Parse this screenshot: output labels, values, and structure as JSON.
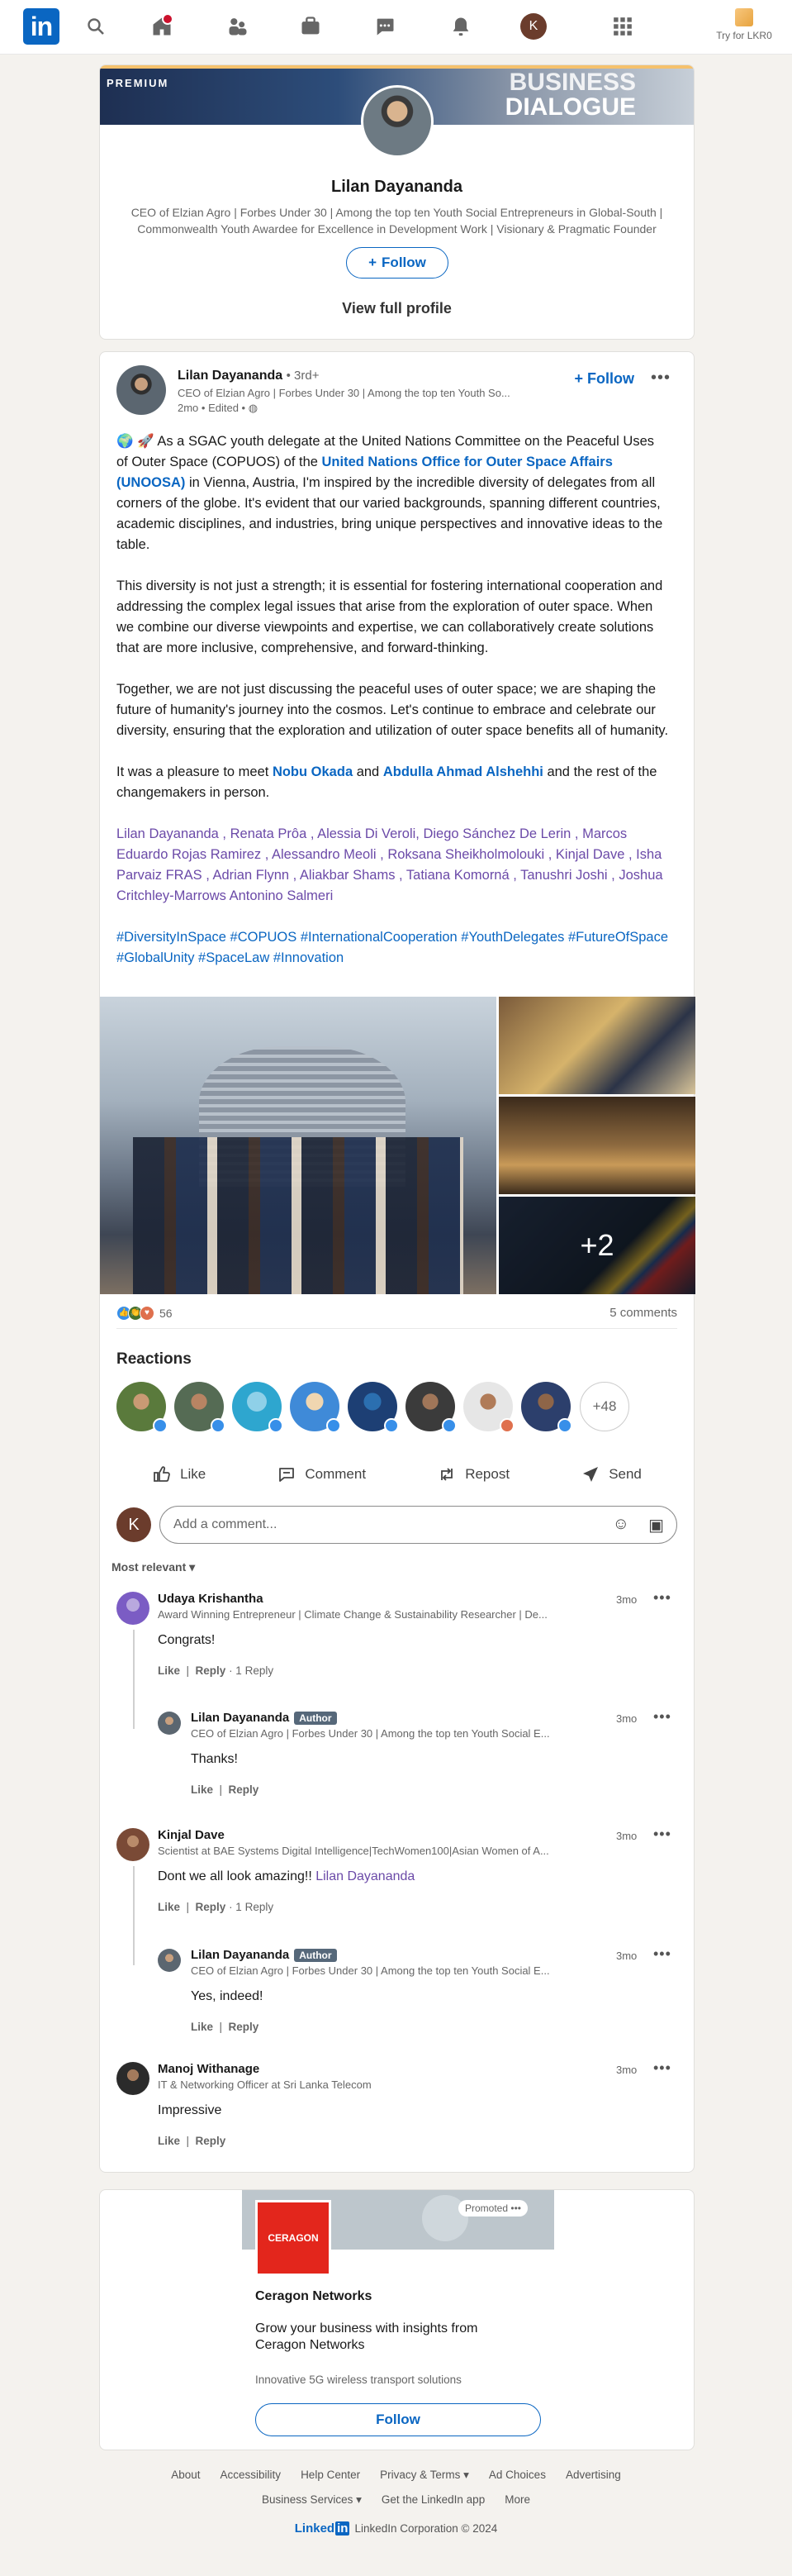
{
  "nav": {
    "logo": "in",
    "me_initial": "K",
    "premium_label": "Try for LKR0"
  },
  "profile_card": {
    "banner_label": "PREMIUM",
    "banner_text_1": "BUSINESS",
    "banner_text_2": "DIALOGUE",
    "name": "Lilan Dayananda",
    "headline": "CEO of Elzian Agro | Forbes Under 30 | Among the top ten Youth Social Entrepreneurs in Global-South | Commonwealth Youth Awardee for Excellence in Development Work | Visionary & Pragmatic Founder",
    "follow_label": "Follow",
    "view_profile_label": "View full profile"
  },
  "post": {
    "author": "Lilan Dayananda",
    "degree": "• 3rd+",
    "headline": "CEO of Elzian Agro | Forbes Under 30 | Among the top ten Youth So...",
    "time": "2mo • Edited •",
    "follow_label": "Follow",
    "p1_a": "🌍 🚀 As a SGAC youth delegate at the United Nations Committee on the Peaceful Uses of Outer Space (COPUOS) of the ",
    "p1_link": "United Nations Office for Outer Space Affairs (UNOOSA)",
    "p1_b": " in Vienna, Austria, I'm inspired by the incredible diversity of delegates from all corners of the globe. It's evident that our varied backgrounds, spanning different countries, academic disciplines, and industries, bring unique perspectives and innovative ideas to the table.",
    "p2": "This diversity is not just a strength; it is essential for fostering international cooperation and addressing the complex legal issues that arise from the exploration of outer space. When we combine our diverse viewpoints and expertise, we can collaboratively create solutions that are more inclusive, comprehensive, and forward-thinking.",
    "p3": "Together, we are not just discussing the peaceful uses of outer space; we are shaping the future of humanity's journey into the cosmos. Let's continue to embrace and celebrate our diversity, ensuring that the exploration and utilization of outer space benefits all of humanity.",
    "p4_a": "It was a pleasure to meet ",
    "p4_l1": "Nobu Okada",
    "p4_b": " and ",
    "p4_l2": "Abdulla Ahmad Alshehhi",
    "p4_c": " and the rest of the changemakers in person.",
    "tags": "Lilan Dayananda , Renata Prôa , Alessia Di Veroli, Diego Sánchez De Lerin , Marcos Eduardo Rojas Ramirez , Alessandro Meoli , Roksana Sheikholmolouki , Kinjal Dave , Isha Parvaiz FRAS , Adrian Flynn , Aliakbar Shams , Tatiana Komorná , Tanushri Joshi , Joshua Critchley-Marrows Antonino Salmeri",
    "hashtags": "#DiversityInSpace #COPUOS #InternationalCooperation #YouthDelegates #FutureOfSpace #GlobalUnity #SpaceLaw #Innovation",
    "more_photos": "+2",
    "reaction_count": "56",
    "comments_count": "5 comments",
    "reactions_title": "Reactions",
    "reactions_more": "+48",
    "actions": [
      "Like",
      "Comment",
      "Repost",
      "Send"
    ],
    "add_comment_placeholder": "Add a comment...",
    "sort_label": "Most relevant"
  },
  "comments": [
    {
      "name": "Udaya Krishantha",
      "headline": "Award Winning Entrepreneur | Climate Change & Sustainability Researcher | De...",
      "time": "3mo",
      "text": "Congrats!",
      "like": "Like",
      "reply": "Reply",
      "replies": "· 1 Reply"
    },
    {
      "name": "Lilan Dayananda",
      "badge": "Author",
      "headline": "CEO of Elzian Agro | Forbes Under 30 | Among the top ten Youth Social E...",
      "time": "3mo",
      "text": "Thanks!",
      "like": "Like",
      "reply": "Reply"
    },
    {
      "name": "Kinjal Dave",
      "headline": "Scientist at BAE Systems Digital Intelligence|TechWomen100|Asian Women of A...",
      "time": "3mo",
      "text": "Dont we all look amazing!! ",
      "mention": "Lilan Dayananda",
      "like": "Like",
      "reply": "Reply",
      "replies": "· 1 Reply"
    },
    {
      "name": "Lilan Dayananda",
      "badge": "Author",
      "headline": "CEO of Elzian Agro | Forbes Under 30 | Among the top ten Youth Social E...",
      "time": "3mo",
      "text": "Yes, indeed!",
      "like": "Like",
      "reply": "Reply"
    },
    {
      "name": "Manoj Withanage",
      "headline": "IT & Networking Officer at Sri Lanka Telecom",
      "time": "3mo",
      "text": "Impressive",
      "like": "Like",
      "reply": "Reply"
    }
  ],
  "ad": {
    "promoted": "Promoted",
    "logo_text": "CERAGON",
    "name": "Ceragon Networks",
    "text": "Grow your business with insights from Ceragon Networks",
    "sub": "Innovative 5G wireless transport solutions",
    "follow_label": "Follow"
  },
  "footer": {
    "row1": [
      "About",
      "Accessibility",
      "Help Center",
      "Privacy & Terms ▾",
      "Ad Choices",
      "Advertising"
    ],
    "row2": [
      "Business Services ▾",
      "Get the LinkedIn app",
      "More"
    ],
    "brand": "Linked",
    "brand_in": "in",
    "copyright": "LinkedIn Corporation © 2024"
  }
}
